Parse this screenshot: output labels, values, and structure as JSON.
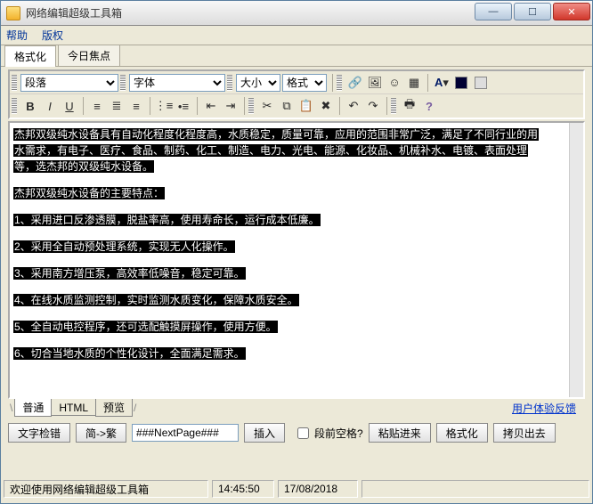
{
  "window": {
    "title": "网络编辑超级工具箱"
  },
  "menu": {
    "help": "帮助",
    "copyright": "版权"
  },
  "top_tabs": {
    "format": "格式化",
    "today": "今日焦点"
  },
  "toolbar1": {
    "para": "段落",
    "font": "字体",
    "size": "大小",
    "style": "格式"
  },
  "content": {
    "p1": "杰邦双级纯水设备具有自动化程度化程度高，水质稳定，质量可靠，应用的范围非常广泛，满足了不同行业的用",
    "p1b": "水需求，有电子、医疗、食品、制药、化工、制造、电力、光电、能源、化妆品、机械补水、电镀、表面处理",
    "p1c": "等，选杰邦的双级纯水设备。",
    "p2": "杰邦双级纯水设备的主要特点：",
    "l1": "1、采用进口反渗透膜，脱盐率高，使用寿命长，运行成本低廉。",
    "l2": "2、采用全自动预处理系统，实现无人化操作。",
    "l3": "3、采用南方增压泵，高效率低噪音，稳定可靠。",
    "l4": "4、在线水质监测控制，实时监测水质变化，保障水质安全。",
    "l5": "5、全自动电控程序，还可选配触摸屏操作，使用方便。",
    "l6": "6、切合当地水质的个性化设计，全面满足需求。"
  },
  "lower_tabs": {
    "normal": "普通",
    "html": "HTML",
    "preview": "预览"
  },
  "feedback": "用户体验反馈",
  "buttons": {
    "spellcheck": "文字检错",
    "simp2trad": "简->繁",
    "nextpage_value": "###NextPage###",
    "insert": "插入",
    "trim_label": "段前空格?",
    "paste": "粘贴进来",
    "format": "格式化",
    "copyout": "拷贝出去"
  },
  "status": {
    "welcome": "欢迎使用网络编辑超级工具箱",
    "time": "14:45:50",
    "date": "17/08/2018"
  }
}
